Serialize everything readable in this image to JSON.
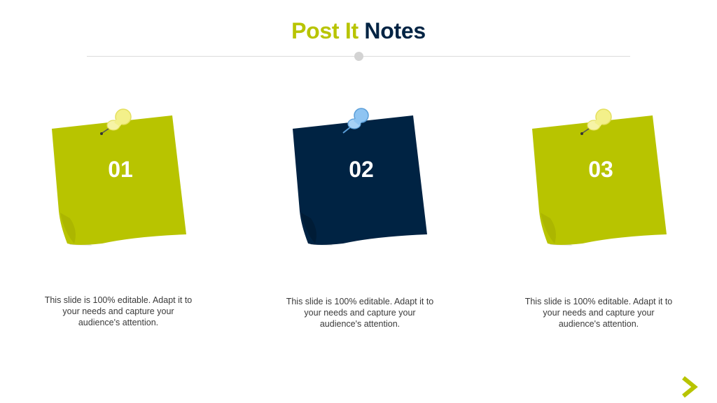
{
  "title": {
    "word1": "Post It",
    "word2": "Notes"
  },
  "colors": {
    "accent": "#b8c400",
    "navy": "#002343",
    "pin_yellow": "#f3f08a",
    "pin_blue": "#8ec4f2"
  },
  "notes": [
    {
      "number": "01",
      "color": "#b8c400",
      "pin": "yellow-pushpin-icon",
      "text": "This slide is 100% editable. Adapt it to your needs and capture your audience's attention."
    },
    {
      "number": "02",
      "color": "#002343",
      "pin": "blue-pushpin-icon",
      "text": "This slide is 100% editable. Adapt it to your needs and capture your audience's attention."
    },
    {
      "number": "03",
      "color": "#b8c400",
      "pin": "yellow-pushpin-icon",
      "text": "This slide is 100% editable. Adapt it to your needs and capture your audience's attention."
    }
  ],
  "nav": {
    "icon": "chevron-right-icon"
  }
}
